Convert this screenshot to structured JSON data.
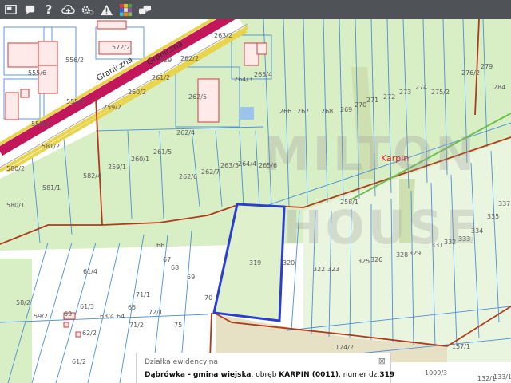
{
  "toolbar": {
    "buttons": [
      {
        "icon": "layers-icon"
      },
      {
        "icon": "chat-bubble-icon"
      },
      {
        "icon": "help-icon",
        "glyph": "?"
      },
      {
        "icon": "upload-cloud-icon"
      },
      {
        "icon": "settings-gears-icon"
      },
      {
        "icon": "warning-road-icon"
      },
      {
        "icon": "color-grid-icon"
      },
      {
        "icon": "comment-icon"
      }
    ]
  },
  "map": {
    "colors": {
      "residential": "#ffffff",
      "field": "#d8eec5",
      "parcel_line": "#4a90d9",
      "highway": "#c2185b",
      "highway_edge": "#e8d44d",
      "boundary": "#b03a1a",
      "selected": "#2a3fcf",
      "building": "#e06a6a"
    },
    "village_name": "Karpin",
    "road_labels": [
      "Graniczna",
      "Graniczna"
    ],
    "watermark": {
      "line1": "MILTON",
      "line2": "HOUSE"
    },
    "parcel_labels": [
      "556/2",
      "572/2",
      "263/2",
      "229",
      "262/2",
      "555/6",
      "555/5",
      "261/2",
      "264/3",
      "265/4",
      "259/2",
      "260/2",
      "262/5",
      "555/3",
      "262/4",
      "266",
      "267",
      "268",
      "269",
      "270",
      "271",
      "272",
      "273",
      "274",
      "275/2",
      "276/2",
      "279",
      "284",
      "581/2",
      "580/2",
      "261/5",
      "259/1",
      "260/1",
      "582/4",
      "262/6",
      "262/7",
      "263/5",
      "264/4",
      "265/6",
      "581/1",
      "580/1",
      "258/1",
      "66",
      "67",
      "68",
      "69",
      "70",
      "319",
      "320",
      "322",
      "323",
      "325",
      "326",
      "328",
      "329",
      "331",
      "332",
      "333",
      "334",
      "335",
      "337",
      "61/4",
      "61/3",
      "69",
      "58/2",
      "59/2",
      "63/4",
      "64",
      "65",
      "71/1",
      "72/1",
      "71/2",
      "75",
      "62/2",
      "61/2",
      "124/2",
      "157/1",
      "1009/3",
      "132/1",
      "133/1"
    ]
  },
  "popup": {
    "title": "Działka ewidencyjna",
    "name": "Dąbrówka - gmina wiejska",
    "obreb_label": ", obręb ",
    "obreb": "KARPIN (0011)",
    "numer_label": ", numer dz.",
    "numer": "319",
    "close_glyph": "⊠"
  }
}
